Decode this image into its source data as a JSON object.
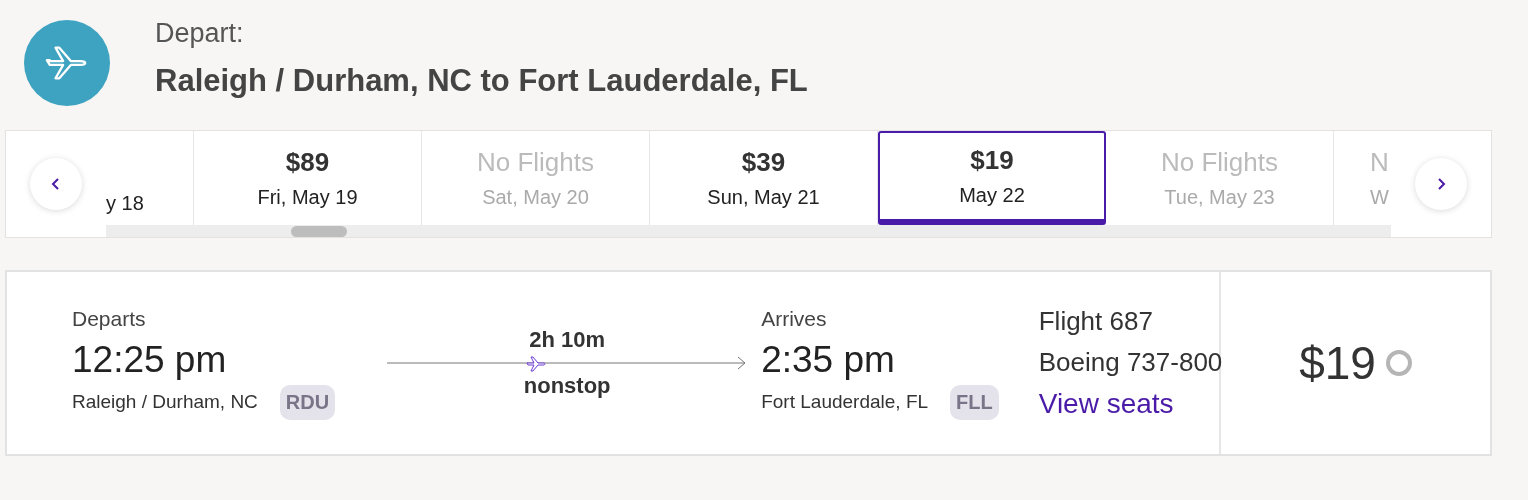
{
  "header": {
    "label": "Depart:",
    "route": "Raleigh / Durham, NC to Fort Lauderdale, FL"
  },
  "dates": [
    {
      "kind": "start",
      "date": "y 18",
      "available": true,
      "selected": false
    },
    {
      "kind": "full",
      "price": "$89",
      "date": "Fri, May 19",
      "available": true,
      "selected": false
    },
    {
      "kind": "full",
      "price": "No Flights",
      "date": "Sat, May 20",
      "available": false,
      "selected": false
    },
    {
      "kind": "full",
      "price": "$39",
      "date": "Sun, May 21",
      "available": true,
      "selected": false
    },
    {
      "kind": "full",
      "price": "$19",
      "date": "May 22",
      "available": true,
      "selected": true
    },
    {
      "kind": "full",
      "price": "No Flights",
      "date": "Tue, May 23",
      "available": false,
      "selected": false
    },
    {
      "kind": "end",
      "price": "N",
      "date": "W",
      "available": false,
      "selected": false
    }
  ],
  "flight": {
    "departs_label": "Departs",
    "depart_time": "12:25 pm",
    "origin": "Raleigh / Durham, NC",
    "origin_code": "RDU",
    "duration": "2h 10m",
    "stops": "nonstop",
    "arrives_label": "Arrives",
    "arrive_time": "2:35 pm",
    "destination": "Fort Lauderdale, FL",
    "destination_code": "FLL",
    "flight_number": "Flight 687",
    "aircraft": "Boeing 737-800",
    "seats_link": "View seats",
    "price": "$19",
    "selected": false
  }
}
